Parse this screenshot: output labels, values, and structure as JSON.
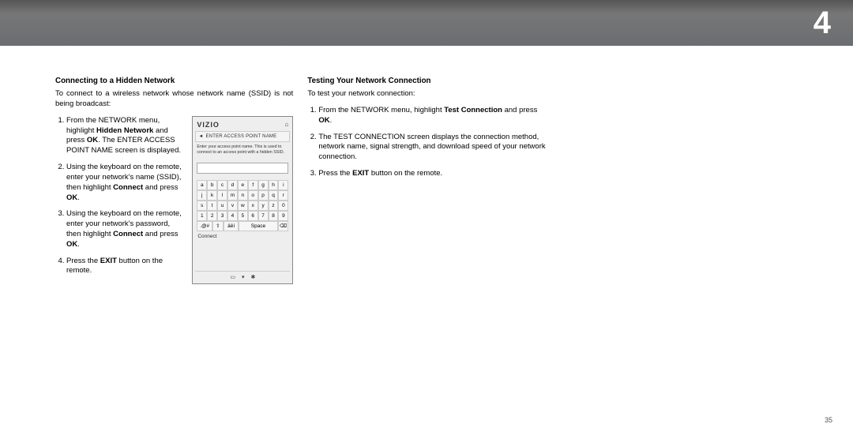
{
  "chapter_number": "4",
  "page_number": "35",
  "left_col": {
    "heading": "Connecting to a Hidden Network",
    "intro": "To connect to a wireless network whose network name (SSID) is not being broadcast:",
    "steps": {
      "s1a": "From the NETWORK menu, highlight ",
      "s1b": "Hidden Network",
      "s1c": " and press ",
      "s1d": "OK",
      "s1e": ". The ENTER ACCESS POINT NAME screen is displayed.",
      "s2a": "Using the keyboard on the remote, enter your network's name (SSID), then highlight ",
      "s2b": "Connect",
      "s2c": " and press ",
      "s2d": "OK",
      "s2e": ".",
      "s3a": "Using the keyboard on the remote, enter your network's password, then highlight ",
      "s3b": "Connect",
      "s3c": " and press ",
      "s3d": "OK",
      "s3e": ".",
      "s4a": "Press the ",
      "s4b": "EXIT",
      "s4c": " button on the remote."
    }
  },
  "right_col": {
    "heading": "Testing Your Network Connection",
    "intro": "To test your network connection:",
    "steps": {
      "s1a": "From the NETWORK menu, highlight ",
      "s1b": "Test Connection",
      "s1c": " and press ",
      "s1d": "OK",
      "s1e": ".",
      "s2": "The TEST CONNECTION screen displays the connection method, network name, signal strength, and download speed of your network connection.",
      "s3a": "Press the ",
      "s3b": "EXIT",
      "s3c": " button on the remote."
    }
  },
  "osd": {
    "brand": "VIZIO",
    "title": "ENTER ACCESS POINT NAME",
    "hint": "Enter your access point name. This is used to connect to an access point with a hidden SSID.",
    "row1": [
      "a",
      "b",
      "c",
      "d",
      "e",
      "f",
      "g",
      "h",
      "i"
    ],
    "row2": [
      "j",
      "k",
      "l",
      "m",
      "n",
      "o",
      "p",
      "q",
      "r"
    ],
    "row3": [
      "s",
      "t",
      "u",
      "v",
      "w",
      "x",
      "y",
      "z",
      "0"
    ],
    "row4": [
      "1",
      "2",
      "3",
      "4",
      "5",
      "6",
      "7",
      "8",
      "9"
    ],
    "row5_sym": ".@#",
    "row5_shift": "⇧",
    "row5_accent": "äêí",
    "row5_space": "Space",
    "row5_bksp": "⌫",
    "connect": "Connect"
  }
}
